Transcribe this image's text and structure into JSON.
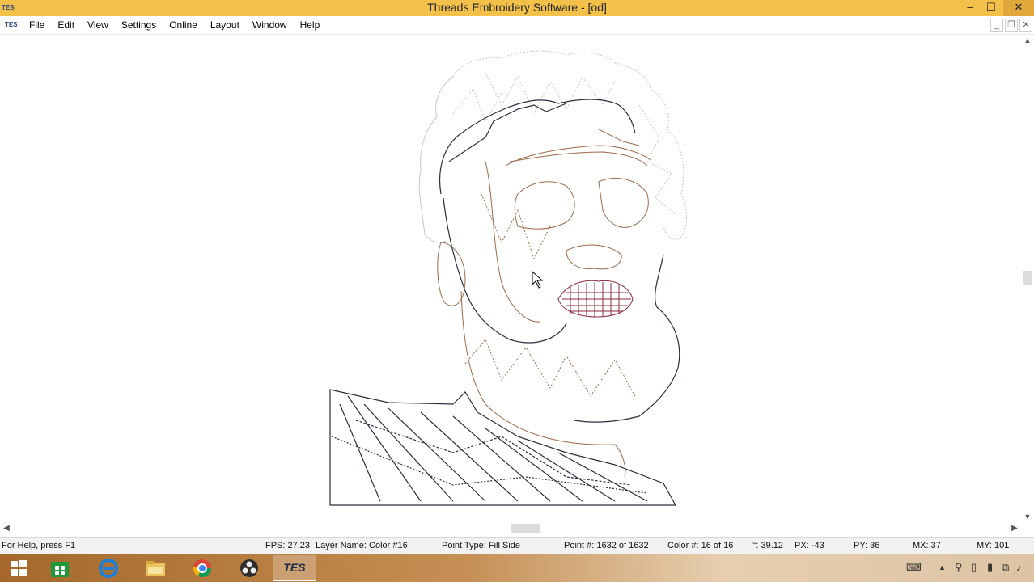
{
  "window": {
    "title": "Threads Embroidery Software - [od]",
    "app_icon_text": "TES",
    "minimize": "–",
    "maximize": "☐",
    "close": "✕"
  },
  "menubar": {
    "items": [
      "File",
      "Edit",
      "View",
      "Settings",
      "Online",
      "Layout",
      "Window",
      "Help"
    ],
    "doc_minimize": "_",
    "doc_restore": "❐",
    "doc_close": "✕"
  },
  "scrollbars": {
    "up": "▲",
    "down": "▼",
    "left": "◀",
    "right": "▶"
  },
  "status": {
    "help": "For Help, press F1",
    "fps": "FPS: 27.23",
    "layer": "Layer Name: Color #16",
    "point_type": "Point Type: Fill Side",
    "point": "Point #: 1632 of 1632",
    "color": "Color #: 16 of 16",
    "angle": "°: 39.12",
    "px": "PX: -43",
    "py": "PY: 36",
    "mx": "MX:  37",
    "my": "MY: 101"
  },
  "taskbar": {
    "tes_label": "TES"
  },
  "colors": {
    "titlebar": "#f3c14a",
    "stitch_dark": "#2a2d3e",
    "stitch_brown": "#9b6a48",
    "stitch_light": "#c9c3d6",
    "stitch_lips": "#8a2b3a"
  }
}
